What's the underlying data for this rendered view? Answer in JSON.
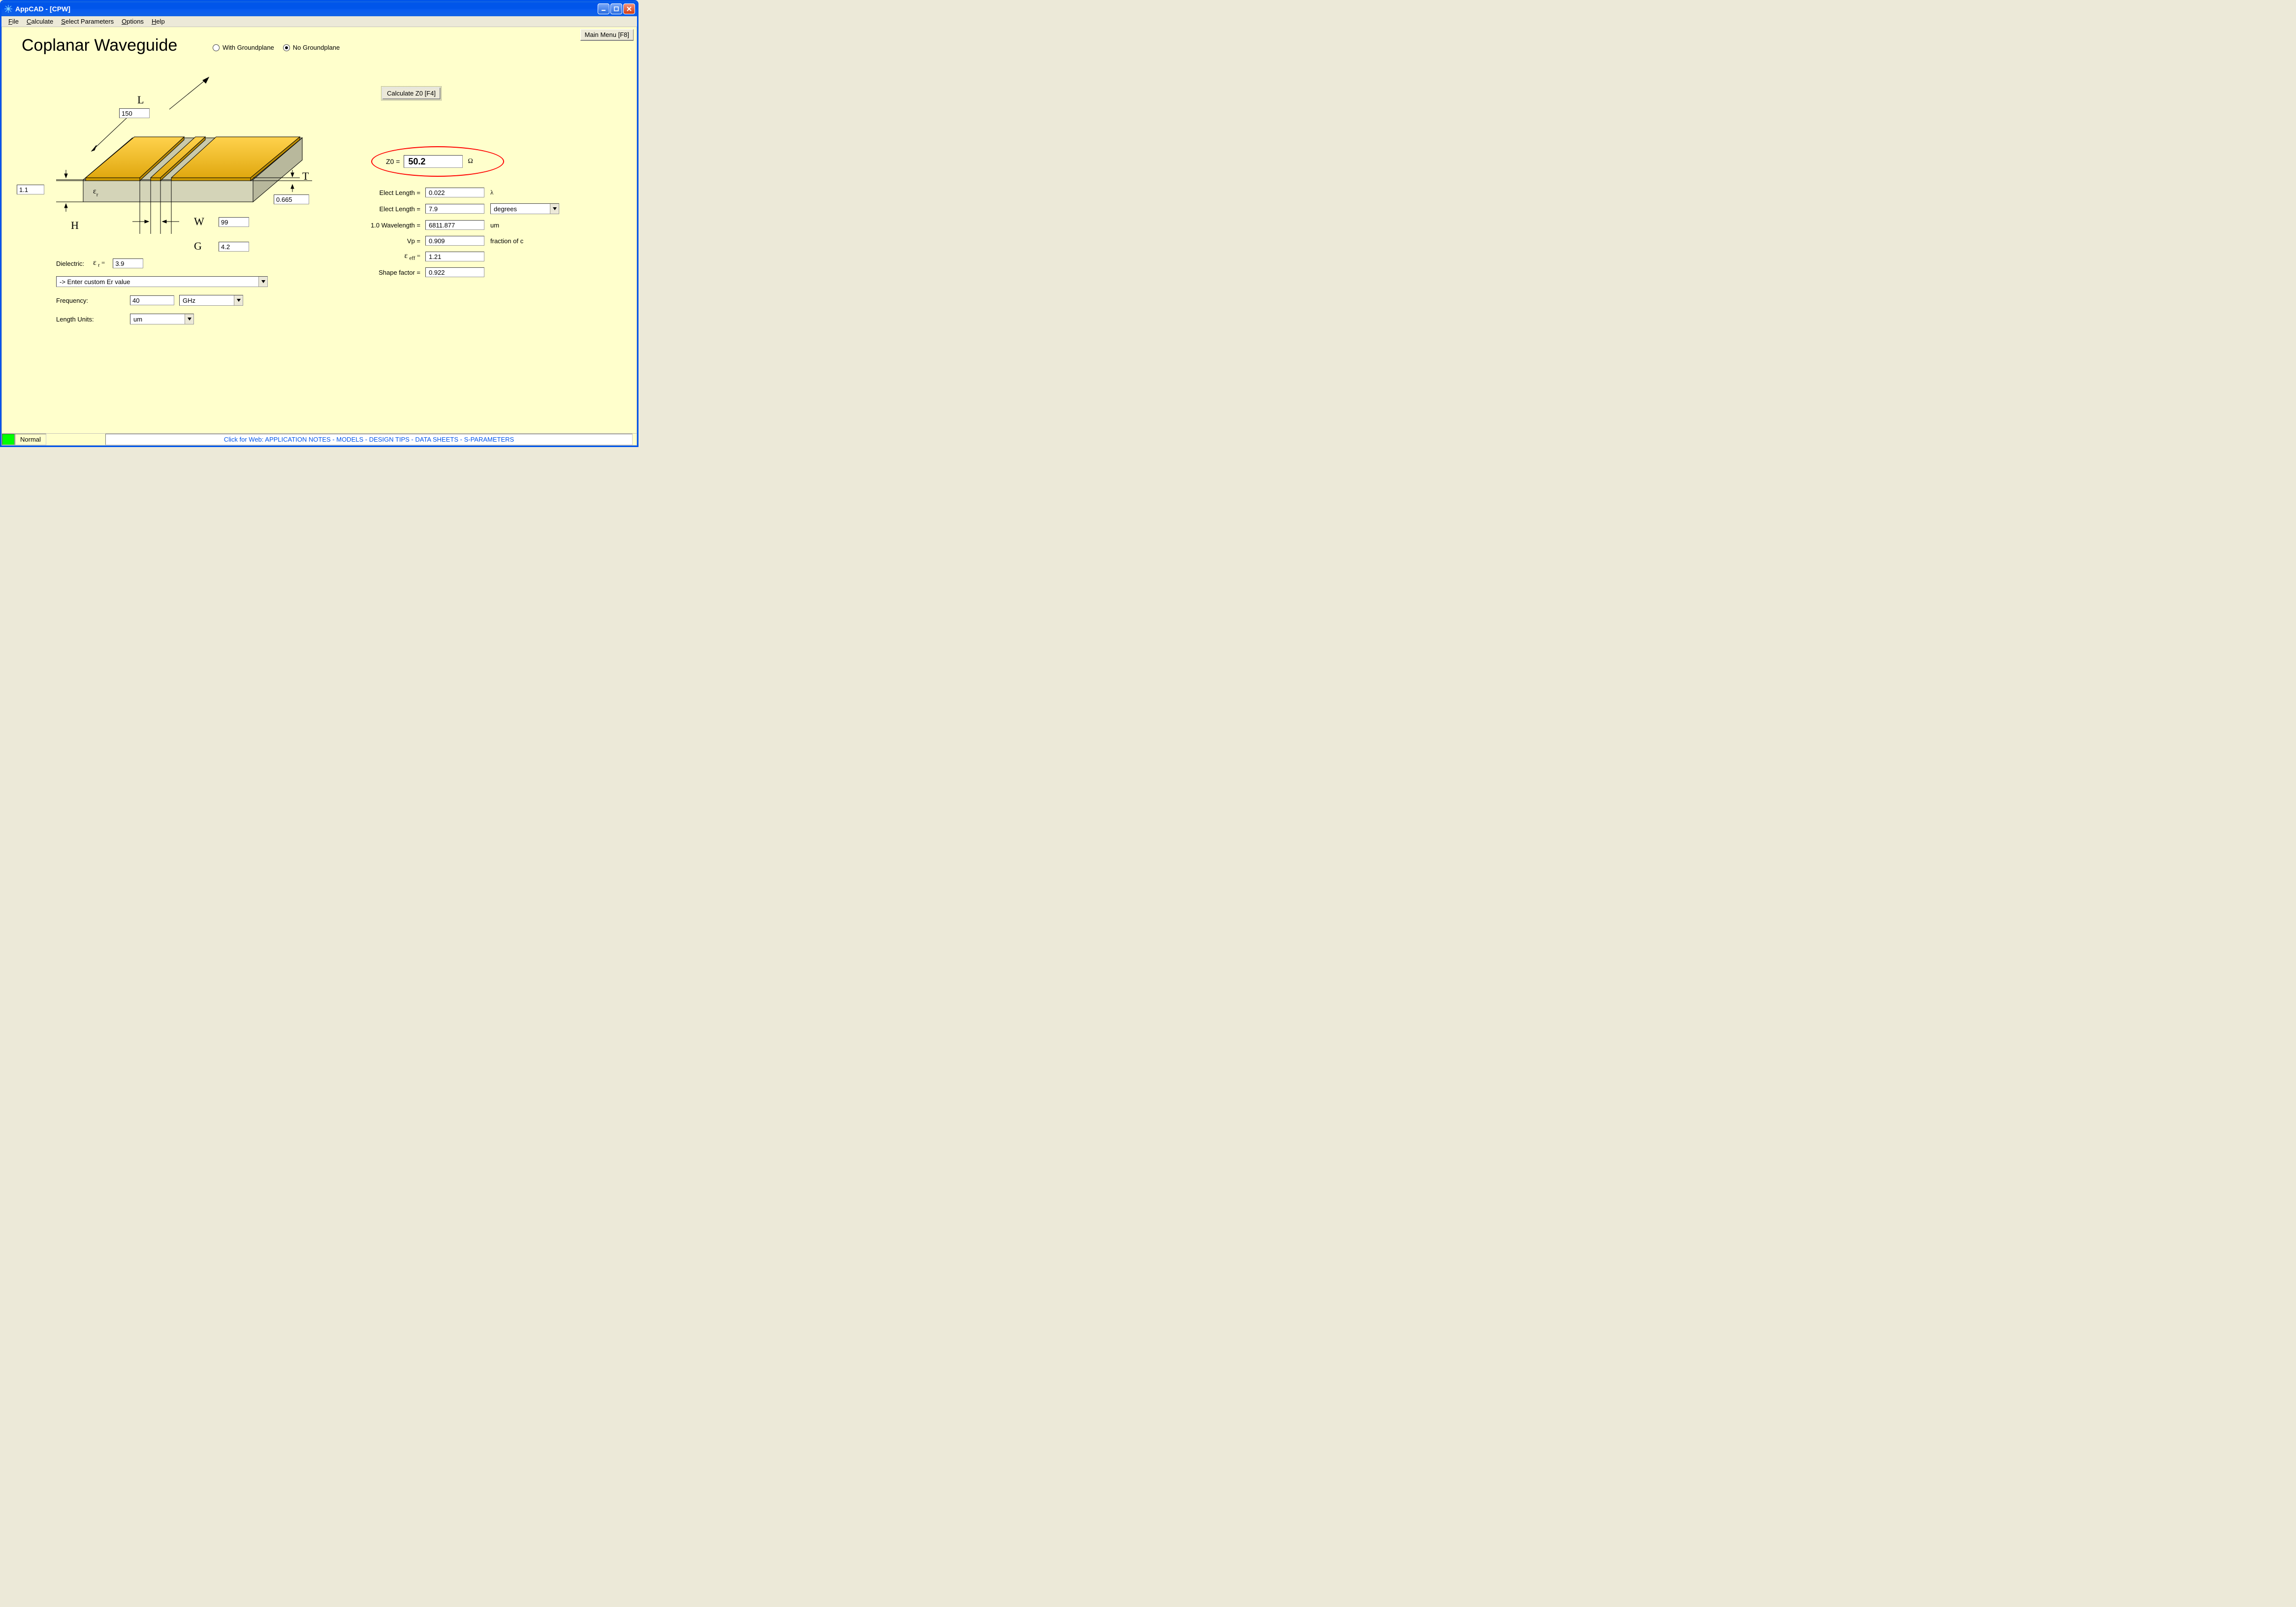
{
  "window": {
    "title": "AppCAD - [CPW]"
  },
  "menubar": {
    "items": [
      {
        "label": "File",
        "mn": "F"
      },
      {
        "label": "Calculate",
        "mn": "C"
      },
      {
        "label": "Select Parameters",
        "mn": "S"
      },
      {
        "label": "Options",
        "mn": "O"
      },
      {
        "label": "Help",
        "mn": "H"
      }
    ]
  },
  "main_menu_btn": "Main Menu [F8]",
  "page_title": "Coplanar Waveguide",
  "gp_radio": {
    "with": "With Groundplane",
    "no": "No Groundplane",
    "selected": "no"
  },
  "calc_btn": "Calculate Z0  [F4]",
  "diagram": {
    "L_label": "L",
    "L_value": "150",
    "T_label": "T",
    "T_value": "0.665",
    "H_label": "H",
    "H_value": "1.1",
    "W_label": "W",
    "W_value": "99",
    "G_label": "G",
    "G_value": "4.2",
    "er_label": "εr"
  },
  "left": {
    "dielectric_label": "Dielectric:",
    "er_symbol_html": "ε r =",
    "er_value": "3.9",
    "er_dropdown": "-> Enter custom Er value",
    "frequency_label": "Frequency:",
    "frequency_value": "40",
    "freq_units": "GHz",
    "length_units_label": "Length Units:",
    "length_units": "um"
  },
  "outputs": {
    "z0_label": "Z0 =",
    "z0_value": "50.2",
    "z0_unit": "Ω",
    "elect_len_lambda_label": "Elect Length =",
    "elect_len_lambda_value": "0.022",
    "lambda_unit": "λ",
    "elect_len_deg_label": "Elect Length =",
    "elect_len_deg_value": "7.9",
    "deg_units": "degrees",
    "wavelength_label": "1.0 Wavelength =",
    "wavelength_value": "6811.877",
    "wavelength_unit": "um",
    "vp_label": "Vp =",
    "vp_value": "0.909",
    "vp_unit": "fraction of c",
    "eeff_label_html": "ε eff =",
    "eeff_value": "1.21",
    "shape_label": "Shape factor =",
    "shape_value": "0.922"
  },
  "status": {
    "mode": "Normal",
    "weblink": "Click for Web: APPLICATION NOTES - MODELS - DESIGN TIPS - DATA SHEETS - S-PARAMETERS"
  }
}
